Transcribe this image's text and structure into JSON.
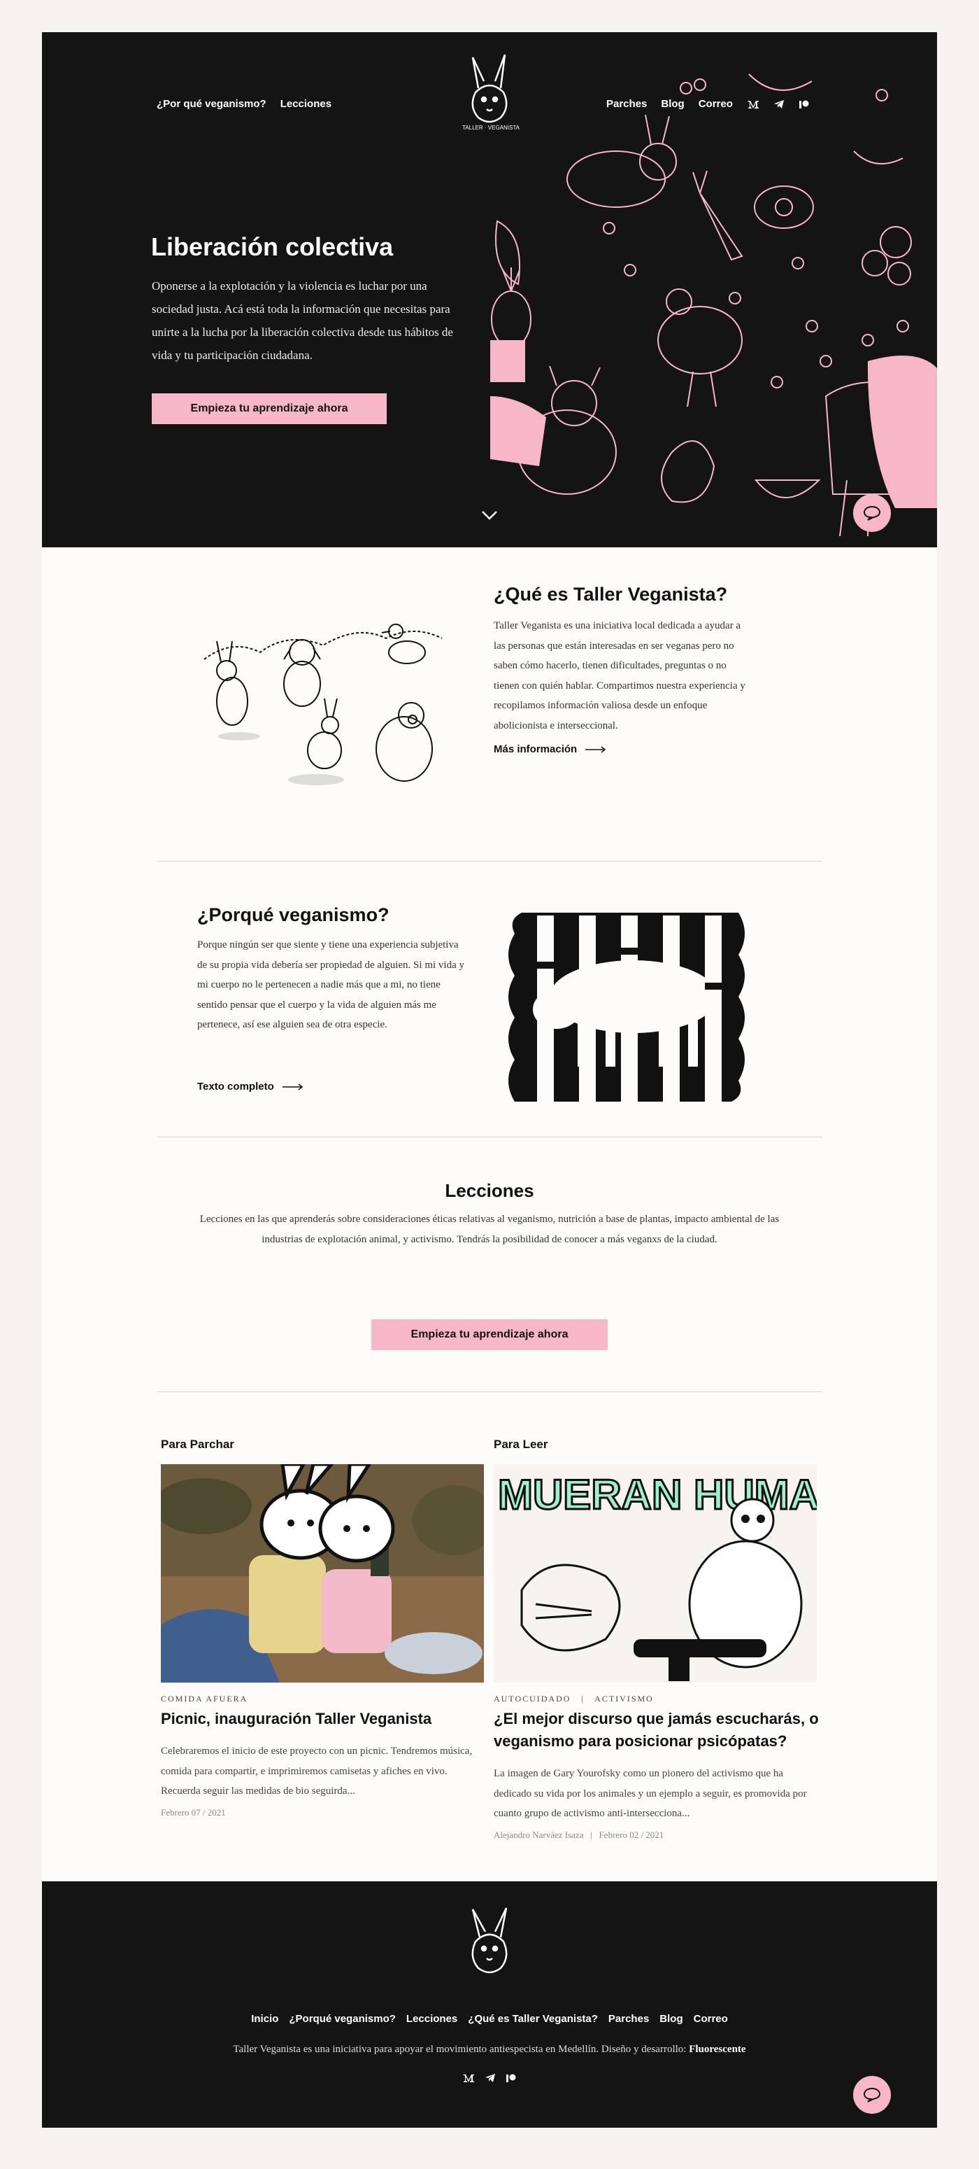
{
  "header": {
    "nav_left": [
      "¿Por qué veganismo?",
      "Lecciones"
    ],
    "nav_right": [
      "Parches",
      "Blog",
      "Correo"
    ],
    "logo_text": "TALLER · VEGANISTA"
  },
  "hero": {
    "title": "Liberación colectiva",
    "text": "Oponerse a la explotación y la violencia es luchar por una sociedad justa. Acá está toda la información que necesitas para unirte a la lucha por la liberación colectiva desde tus hábitos de vida y tu participación ciudadana.",
    "cta": "Empieza tu aprendizaje ahora"
  },
  "about": {
    "title": "¿Qué es Taller Veganista?",
    "text": "Taller Veganista es una iniciativa local dedicada a ayudar a las personas que están interesadas en ser veganas pero no saben cómo hacerlo, tienen dificultades, preguntas o no tienen con quién hablar. Compartimos nuestra experiencia y recopilamos información valiosa desde un enfoque abolicionista e interseccional.",
    "link": "Más información"
  },
  "why": {
    "title": "¿Porqué veganismo?",
    "text": "Porque ningún ser que siente y tiene una experiencia subjetiva de su propia vida debería ser propiedad de alguien. Si mi vida y mi cuerpo no le pertenecen a nadie más que a mi, no tiene sentido pensar que el cuerpo y la vida de alguien más me pertenece, así ese alguien sea de otra especie.",
    "link": "Texto completo"
  },
  "lessons": {
    "title": "Lecciones",
    "text": "Lecciones en las que aprenderás sobre consideraciones éticas relativas al veganismo, nutrición a base de plantas, impacto ambiental de las industrias de explotación animal, y activismo. Tendrás la posibilidad de conocer a más veganxs de la ciudad.",
    "cta": "Empieza tu aprendizaje ahora"
  },
  "posts": [
    {
      "section": "Para Parchar",
      "tags": "COMIDA AFUERA",
      "title": "Picnic, inauguración Taller Veganista",
      "excerpt": "Celebraremos el inicio de este proyecto con un picnic. Tendremos música, comida para compartir, e imprimiremos camisetas y afiches en vivo. Recuerda seguir las medidas de bio seguirda...",
      "meta": "Febrero 07 / 2021"
    },
    {
      "section": "Para Leer",
      "tags": "AUTOCUIDADO   |   ACTIVISMO",
      "title": "¿El mejor discurso que jamás escucharás, o veganismo para posicionar psicópatas?",
      "excerpt": "La imagen de Gary Yourofsky como un pionero del activismo que ha dedicado su vida por los animales y un ejemplo a seguir, es promovida por cuanto grupo de activismo anti-intersecciona...",
      "meta": "Alejandro Narváez Isaza   |   Febrero 02 / 2021",
      "image_text": "MUERAN HUMANOS!"
    }
  ],
  "footer": {
    "nav": [
      "Inicio",
      "¿Porqué veganismo?",
      "Lecciones",
      "¿Qué es Taller Veganista?",
      "Parches",
      "Blog",
      "Correo"
    ],
    "credit": "Taller Veganista es una iniciativa para apoyar el movimiento antiespecista en Medellín. Diseño y desarrollo:",
    "credit_link": "Fluorescente"
  },
  "colors": {
    "dark": "#141414",
    "pink": "#f8b6c9",
    "background": "#fdfcfb"
  },
  "icons": [
    "medium-icon",
    "telegram-icon",
    "patreon-icon",
    "chat-icon",
    "chevron-down-icon",
    "arrow-right-icon"
  ]
}
